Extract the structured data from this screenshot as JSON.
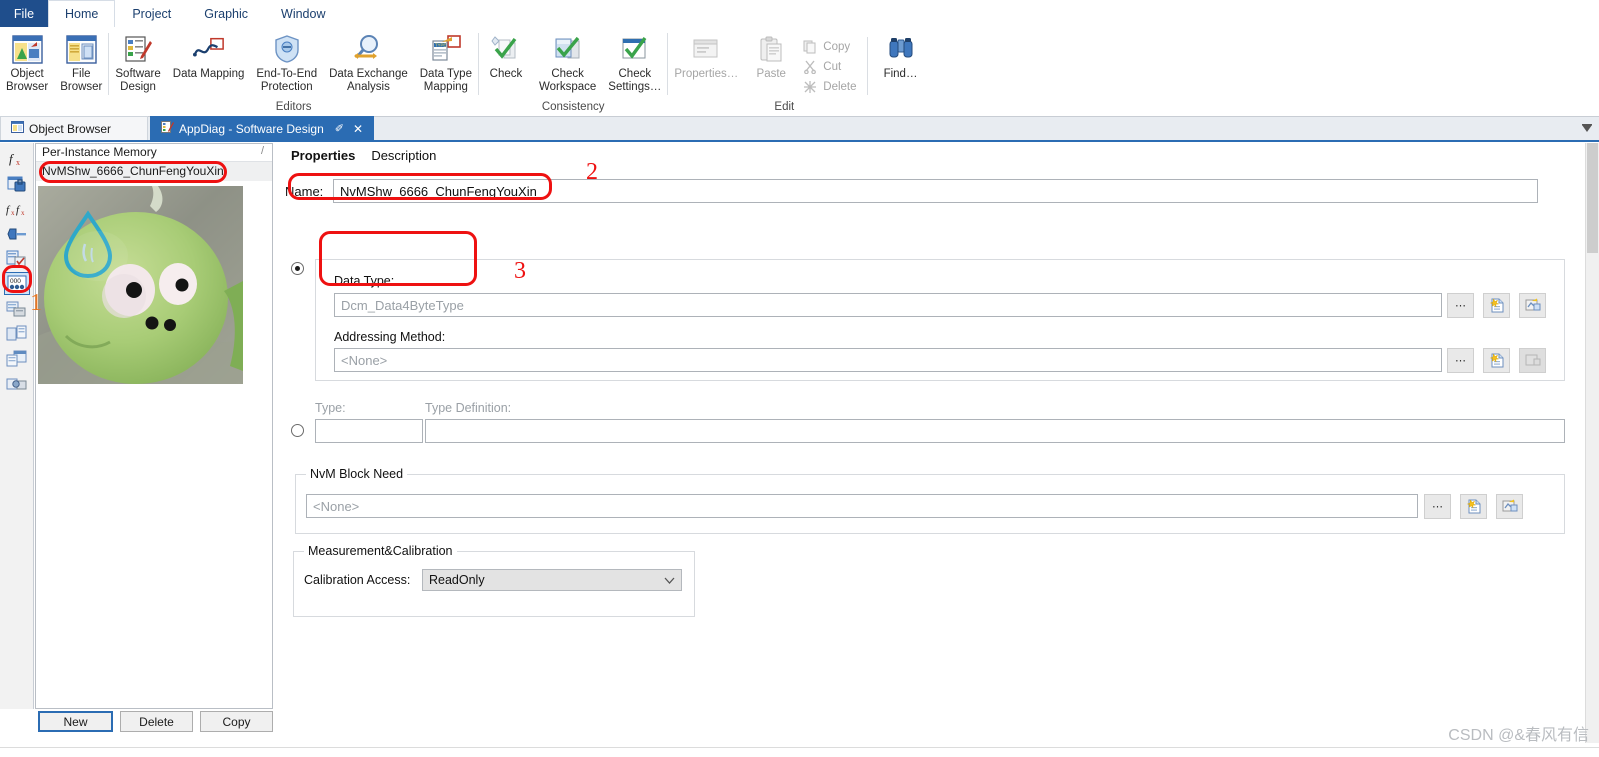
{
  "menu": {
    "file": "File",
    "tabs": [
      "Home",
      "Project",
      "Graphic",
      "Window"
    ],
    "active_tab": "Home"
  },
  "ribbon": {
    "groups": [
      {
        "label": "",
        "buttons": [
          {
            "label": "Object\nBrowser  ",
            "icon": "object-browser-icon",
            "disabled": false
          },
          {
            "label": "File\nBrowser",
            "icon": "file-browser-icon",
            "disabled": false
          }
        ]
      },
      {
        "label": "Editors",
        "buttons": [
          {
            "label": "Software\nDesign",
            "icon": "software-design-icon",
            "disabled": false
          },
          {
            "label": "Data Mapping",
            "icon": "data-mapping-icon",
            "disabled": false
          },
          {
            "label": "End-To-End\nProtection",
            "icon": "end-to-end-protection-icon",
            "disabled": false
          },
          {
            "label": "Data Exchange\nAnalysis",
            "icon": "data-exchange-analysis-icon",
            "disabled": false
          },
          {
            "label": "Data Type\nMapping",
            "icon": "data-type-mapping-icon",
            "disabled": false
          }
        ]
      },
      {
        "label": "Consistency",
        "buttons": [
          {
            "label": "Check",
            "icon": "check-icon",
            "disabled": false
          },
          {
            "label": "Check\nWorkspace",
            "icon": "check-workspace-icon",
            "disabled": false
          },
          {
            "label": "Check\nSettings…",
            "icon": "check-settings-icon",
            "disabled": false
          }
        ]
      },
      {
        "label": "Edit",
        "buttons": [
          {
            "label": "Properties…",
            "icon": "properties-icon",
            "disabled": true
          },
          {
            "label": "Paste",
            "icon": "paste-icon",
            "disabled": true
          }
        ],
        "small_buttons": [
          {
            "label": "Copy",
            "icon": "copy-icon",
            "disabled": true
          },
          {
            "label": "Cut",
            "icon": "cut-icon",
            "disabled": true
          },
          {
            "label": "Delete",
            "icon": "delete-icon",
            "disabled": true
          }
        ],
        "trailing_buttons": [
          {
            "label": "Find…",
            "icon": "find-binoculars-icon",
            "disabled": false
          }
        ]
      }
    ]
  },
  "doc_tabs": {
    "items": [
      {
        "label": "Object Browser",
        "icon": "object-browser-icon",
        "active": false,
        "closable": false
      },
      {
        "label": "AppDiag - Software Design",
        "icon": "software-design-icon",
        "active": true,
        "closable": true,
        "pin": "✐",
        "close": "✕"
      }
    ],
    "overflow_icon": "chevron-down-icon"
  },
  "icon_strip": {
    "items": [
      {
        "name": "function-x-icon",
        "glyph": "ƒx",
        "selected": false
      },
      {
        "name": "locked-table-icon",
        "glyph": "▤",
        "selected": false
      },
      {
        "name": "function-pair-icon",
        "glyph": "ƒƒ",
        "selected": false
      },
      {
        "name": "pin-port-icon",
        "glyph": "⬌",
        "selected": false
      },
      {
        "name": "document-check-icon",
        "glyph": "▤",
        "selected": false
      },
      {
        "name": "per-instance-memory-icon",
        "glyph": "000",
        "selected": true
      },
      {
        "name": "server-stack-icon",
        "glyph": "▤",
        "selected": false
      },
      {
        "name": "copy-blocks-icon",
        "glyph": "▤",
        "selected": false
      },
      {
        "name": "table-blocks-icon",
        "glyph": "▤",
        "selected": false
      },
      {
        "name": "gear-blocks-icon",
        "glyph": "▤",
        "selected": false
      }
    ]
  },
  "list_panel": {
    "header": "Per-Instance Memory",
    "header_right_mark": "/",
    "selected_item": "NvMShw_6666_ChunFengYouXin",
    "thumbnail_alt": "green-character-photo",
    "buttons": {
      "new": "New",
      "delete": "Delete",
      "copy": "Copy"
    }
  },
  "properties": {
    "tabs": [
      {
        "label": "Properties",
        "active": true
      },
      {
        "label": "Description",
        "active": false
      }
    ],
    "name_label": "Name:",
    "name_value": "NvMShw_6666_ChunFengYouXin",
    "option_a_selected": true,
    "data_type_label": "Data Type:",
    "data_type_value": "Dcm_Data4ByteType",
    "addressing_method_label": "Addressing Method:",
    "addressing_method_value": "<None>",
    "type_label": "Type:",
    "type_value": "",
    "type_definition_label": "Type Definition:",
    "type_definition_value": "",
    "nvm_block_need_title": "NvM Block Need",
    "nvm_block_need_value": "<None>",
    "measurement_calibration_title": "Measurement&Calibration",
    "calibration_access_label": "Calibration Access:",
    "calibration_access_value": "ReadOnly",
    "ellipsis_button": "⋯",
    "new_doc_icon": "new-document-icon",
    "goto_icon": "goto-reference-icon"
  },
  "annotations": {
    "marker1": "1",
    "marker2": "2",
    "marker3": "3",
    "color": "#ee1111",
    "marker1_color": "#e87722"
  },
  "watermark": "CSDN @&春风有信"
}
